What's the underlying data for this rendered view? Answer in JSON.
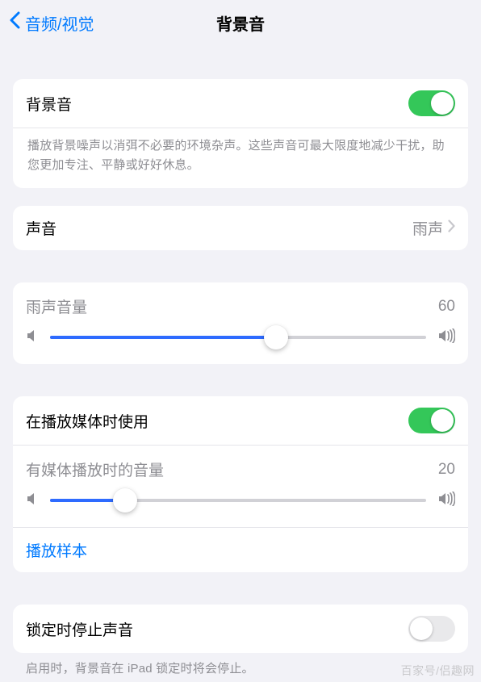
{
  "nav": {
    "back_label": "音频/视觉",
    "title": "背景音"
  },
  "main_toggle": {
    "label": "背景音",
    "on": true,
    "desc": "播放背景噪声以消弭不必要的环境杂声。这些声音可最大限度地减少干扰，助您更加专注、平静或好好休息。"
  },
  "sound_row": {
    "label": "声音",
    "value": "雨声"
  },
  "rain_volume": {
    "label": "雨声音量",
    "value": "60",
    "percent": 60
  },
  "media": {
    "use_label": "在播放媒体时使用",
    "use_on": true,
    "volume_label": "有媒体播放时的音量",
    "volume_value": "20",
    "volume_percent": 20,
    "sample_label": "播放样本"
  },
  "lock": {
    "label": "锁定时停止声音",
    "on": false,
    "desc": "启用时，背景音在 iPad 锁定时将会停止。"
  },
  "watermark": "百家号/侣趣网"
}
